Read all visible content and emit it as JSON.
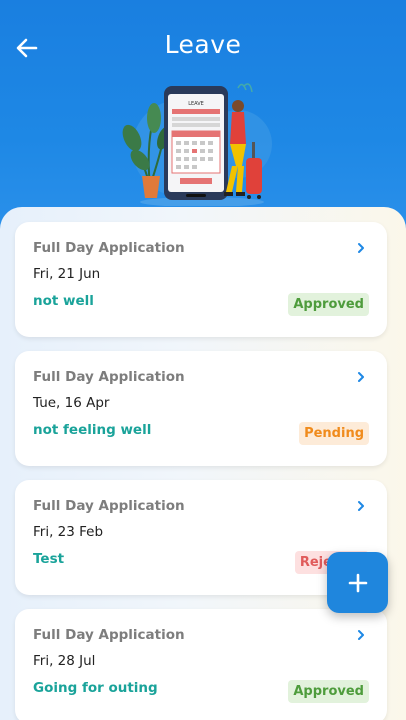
{
  "header": {
    "title": "Leave",
    "back_icon": "arrow-left-icon"
  },
  "colors": {
    "primary": "#1e88e5",
    "approved": "#4e9c3c",
    "pending": "#f08b1c",
    "rejected": "#e05b5b",
    "reason": "#1aa39a"
  },
  "leaves": [
    {
      "type": "Full Day Application",
      "date": "Fri, 21 Jun",
      "reason": "not well",
      "status": "Approved"
    },
    {
      "type": "Full Day Application",
      "date": "Tue, 16 Apr",
      "reason": "not feeling well",
      "status": "Pending"
    },
    {
      "type": "Full Day Application",
      "date": "Fri, 23 Feb",
      "reason": "Test",
      "status": "Rejected"
    },
    {
      "type": "Full Day Application",
      "date": "Fri, 28 Jul",
      "reason": "Going for outing",
      "status": "Approved"
    }
  ],
  "fab": {
    "icon": "plus-icon"
  }
}
